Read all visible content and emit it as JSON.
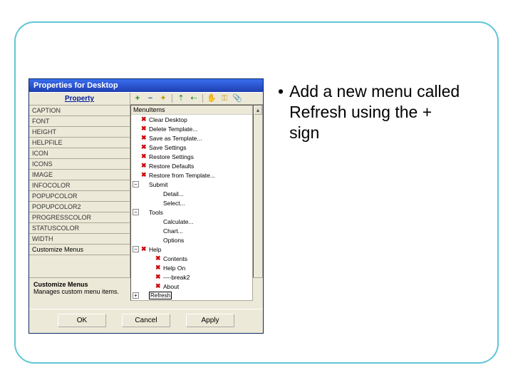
{
  "dialog": {
    "title": "Properties for Desktop",
    "property_link": "Property",
    "props": [
      "CAPTION",
      "FONT",
      "HEIGHT",
      "HELPFILE",
      "ICON",
      "ICONS",
      "IMAGE",
      "INFOCOLOR",
      "POPUPCOLOR",
      "POPUPCOLOR2",
      "PROGRESSCOLOR",
      "STATUSCOLOR",
      "WIDTH"
    ],
    "customize_label": "Customize Menus",
    "toolbar": {
      "plus": "+",
      "minus": "−",
      "wand": "✦",
      "arrow_up": "⇡",
      "arrow_left": "⇠",
      "hand": "✋",
      "key": "⚿",
      "clip": "📎"
    },
    "tree_header": "MenuItems",
    "tree": {
      "root": [
        {
          "x": true,
          "label": "Clear Desktop"
        },
        {
          "x": true,
          "label": "Delete Template..."
        },
        {
          "x": true,
          "label": "Save as Template..."
        },
        {
          "x": true,
          "label": "Save Settings"
        },
        {
          "x": true,
          "label": "Restore Settings"
        },
        {
          "x": true,
          "label": "Restore Defaults"
        },
        {
          "x": true,
          "label": "Restore from Template..."
        }
      ],
      "submit_group": {
        "label": "Submit",
        "children": [
          {
            "label": "Detail..."
          },
          {
            "label": "Select..."
          }
        ]
      },
      "tools_group": {
        "label": "Tools",
        "children": [
          {
            "label": "Calculate..."
          },
          {
            "label": "Chart..."
          },
          {
            "label": "Options"
          }
        ]
      },
      "help_group": {
        "label": "Help",
        "x": true,
        "children": [
          {
            "x": true,
            "label": "Contents"
          },
          {
            "x": true,
            "label": "Help On"
          },
          {
            "x": true,
            "label": "----break2"
          },
          {
            "x": true,
            "label": "About"
          }
        ]
      },
      "refresh": {
        "label": "Refresh"
      }
    },
    "desc": {
      "title": "Customize Menus",
      "text": "Manages custom menu items."
    },
    "buttons": {
      "ok": "OK",
      "cancel": "Cancel",
      "apply": "Apply"
    }
  },
  "instruction": {
    "bullet": "•",
    "text": "Add a new menu called Refresh using the + sign"
  }
}
